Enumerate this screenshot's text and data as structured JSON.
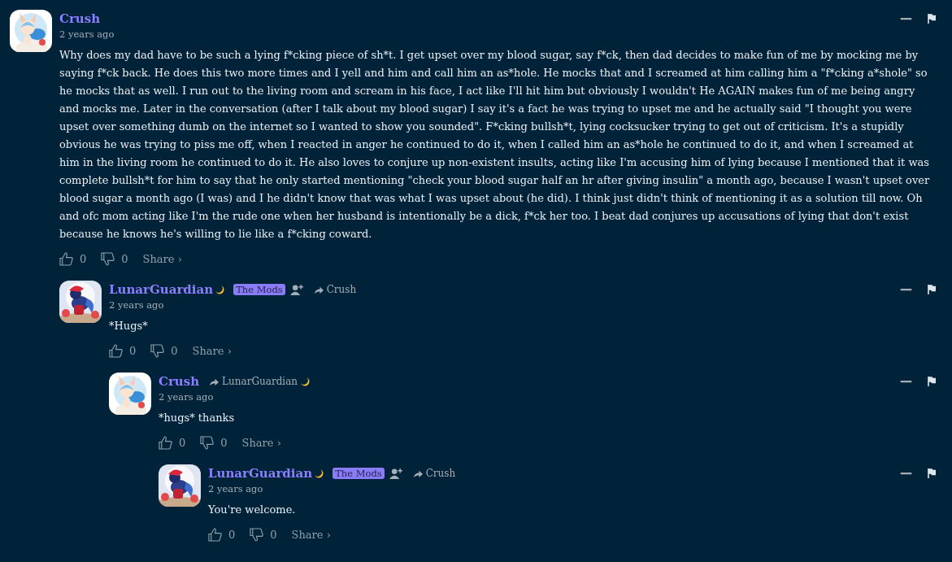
{
  "comments": [
    {
      "author": "Crush",
      "author_moon": false,
      "time": "2 years ago",
      "body": "Why does my dad have to be such a lying f*cking piece of sh*t. I get upset over my blood sugar, say f*ck, then dad decides to make fun of me by mocking me by saying f*ck back. He does this two more times and I yell and him and call him an as*hole. He mocks that and I screamed at him calling him a \"f*cking a*shole\" so he mocks that as well. I run out to the living room and scream in his face, I act like I'll hit him but obviously I wouldn't He AGAIN makes fun of me being angry and mocks me. Later in the conversation (after I talk about my blood sugar) I say it's a fact he was trying to upset me and he actually said \"I thought you were upset over something dumb on the internet so I wanted to show you sounded\". F*cking bullsh*t, lying cocksucker trying to get out of criticism. It's a stupidly obvious he was trying to piss me off, when I reacted in anger he continued to do it, when I called him an as*hole he continued to do it, and when I screamed at him in the living room he continued to do it. He also loves to conjure up non-existent insults, acting like I'm accusing him of lying because I mentioned that it was complete bullsh*t for him to say that he only started mentioning \"check your blood sugar half an hr after giving insulin\" a month ago, because I wasn't upset over blood sugar a month ago (I was) and I he didn't know that was what I was upset about (he did). I think just didn't think of mentioning it as a solution till now. Oh and ofc mom acting like I'm the rude one when her husband is intentionally be a dick, f*ck her too. I beat dad conjures up accusations of lying that don't exist because he knows he's willing to lie like a f*cking coward.",
      "likes": "0",
      "dislikes": "0",
      "share": "Share ›",
      "children": [
        {
          "author": "LunarGuardian",
          "author_moon": true,
          "mod_badge": "The Mods",
          "reply_to": "Crush",
          "reply_to_moon": false,
          "time": "2 years ago",
          "body": "*Hugs*",
          "likes": "0",
          "dislikes": "0",
          "share": "Share ›",
          "children": [
            {
              "author": "Crush",
              "author_moon": false,
              "reply_to": "LunarGuardian",
              "reply_to_moon": true,
              "time": "2 years ago",
              "body": "*hugs* thanks",
              "likes": "0",
              "dislikes": "0",
              "share": "Share ›",
              "children": [
                {
                  "author": "LunarGuardian",
                  "author_moon": true,
                  "mod_badge": "The Mods",
                  "reply_to": "Crush",
                  "reply_to_moon": false,
                  "time": "2 years ago",
                  "body": "You're welcome.",
                  "likes": "0",
                  "dislikes": "0",
                  "share": "Share ›"
                }
              ]
            }
          ]
        }
      ]
    }
  ]
}
